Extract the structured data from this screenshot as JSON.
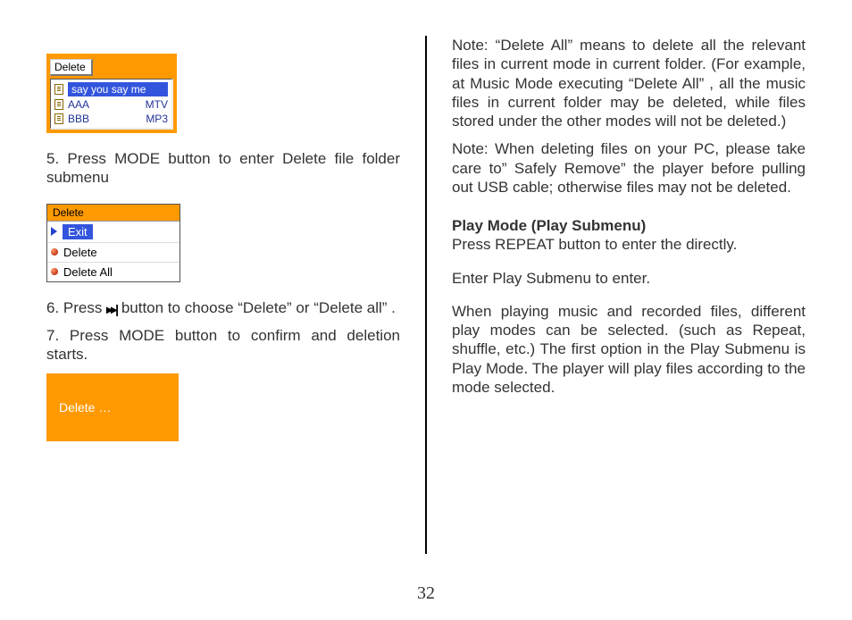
{
  "page_number": "32",
  "left": {
    "ui1": {
      "title": "Delete",
      "rows": [
        {
          "name": "say you say  me",
          "ext": "",
          "selected": true
        },
        {
          "name": "AAA",
          "ext": "MTV",
          "selected": false
        },
        {
          "name": "BBB",
          "ext": "MP3",
          "selected": false
        }
      ]
    },
    "step5": "5. Press MODE button to enter Delete file folder submenu",
    "ui2": {
      "title": "Delete",
      "rows": [
        {
          "label": "Exit",
          "kind": "tri",
          "selected": true
        },
        {
          "label": "Delete",
          "kind": "bullet",
          "selected": false
        },
        {
          "label": "Delete All",
          "kind": "bullet",
          "selected": false
        }
      ]
    },
    "step6_pre": "6. Press ",
    "step6_post": " button to choose “Delete”  or “Delete all” .",
    "next_icon_glyph": "▸▸|",
    "step7": "7. Press MODE button to confirm and deletion starts.",
    "ui3_label": "Delete …"
  },
  "right": {
    "note1": "Note: “Delete All”  means to delete all the relevant files in current mode in current folder. (For example, at Music Mode executing “Delete All” , all the music files in current folder may be deleted, while files stored under the other modes will not be deleted.)",
    "note2": "Note: When deleting files on your PC, please take care to” Safely Remove” the player before pulling out USB cable; otherwise files may not be deleted.",
    "heading": "Play Mode (Play Submenu)",
    "h_line": "Press REPEAT button to enter the directly.",
    "enter_line": "Enter Play Submenu to enter.",
    "desc": "When playing music and recorded files, different play modes can be selected. (such as Repeat, shuffle, etc.) The first option in the Play Submenu is Play Mode. The player will play files according to the mode selected."
  }
}
